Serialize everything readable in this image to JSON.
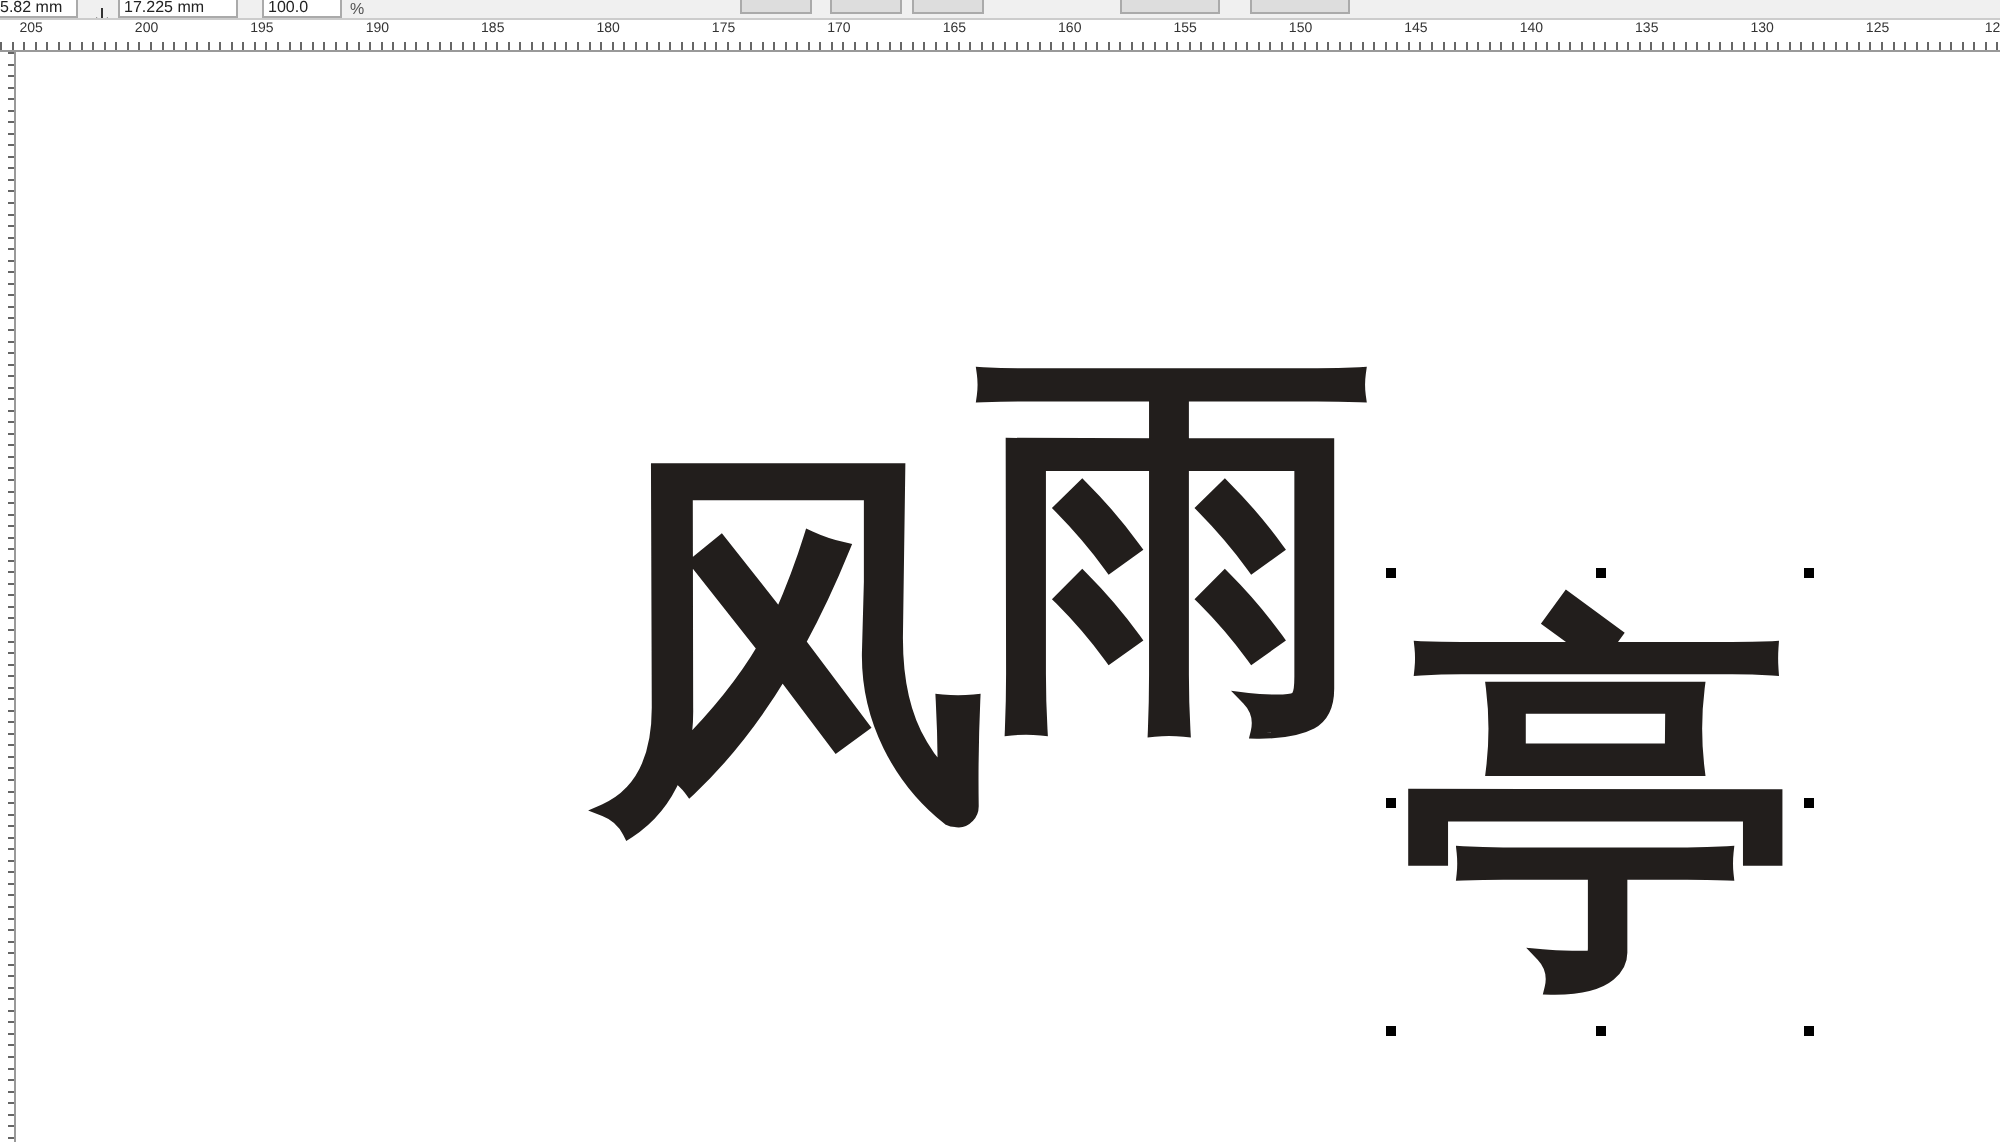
{
  "property_bar": {
    "width_value": "5.82 mm",
    "height_value": "17.225 mm",
    "scale_value": "100.0",
    "scale_unit": "%"
  },
  "ruler": {
    "labels": [
      "205",
      "200",
      "195",
      "190",
      "185",
      "180",
      "175",
      "170",
      "165",
      "160",
      "155",
      "150",
      "145",
      "140",
      "135",
      "130",
      "125",
      "12"
    ]
  },
  "canvas": {
    "lettering": [
      {
        "text": "风",
        "selected": false
      },
      {
        "text": "雨",
        "selected": false
      },
      {
        "text": "亭",
        "selected": true
      }
    ]
  }
}
